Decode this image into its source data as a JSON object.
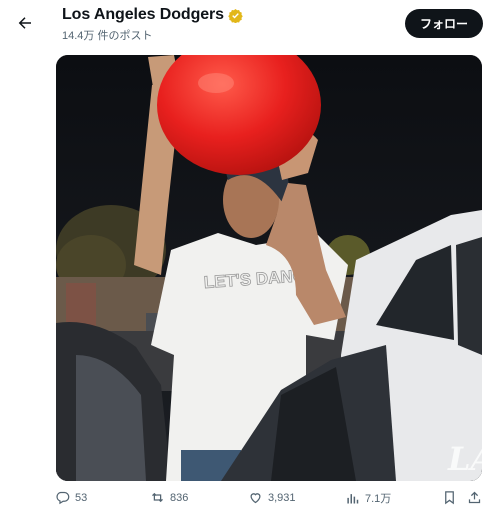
{
  "header": {
    "back_icon": "arrow-left-icon",
    "account_name": "Los Angeles Dodgers",
    "verified_icon": "gold-verified-badge-icon",
    "verified_color": "#e2b719",
    "post_count": "14.4万 件のポスト",
    "follow_label": "フォロー"
  },
  "media": {
    "type": "video-still",
    "shirt_text": "LET'S DANCE",
    "watermark": "LA"
  },
  "actions": {
    "reply_count": "53",
    "repost_count": "836",
    "like_count": "3,931",
    "view_count": "7.1万",
    "reply_icon": "reply-bubble-icon",
    "repost_icon": "repost-icon",
    "like_icon": "heart-icon",
    "views_icon": "bar-chart-icon",
    "bookmark_icon": "bookmark-icon",
    "share_icon": "share-icon"
  },
  "colors": {
    "text_primary": "#0f1419",
    "text_secondary": "#536471",
    "follow_bg": "#0f1419",
    "balloon": "#e8201e"
  }
}
